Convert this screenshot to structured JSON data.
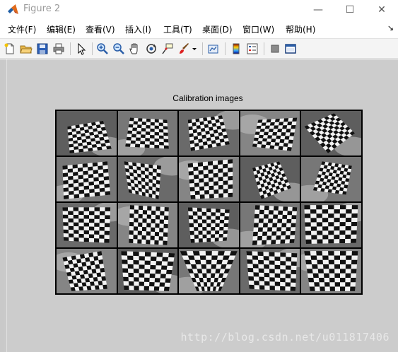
{
  "window": {
    "title": "Figure 2",
    "minimize_glyph": "—",
    "maximize_glyph": "☐",
    "close_glyph": "✕"
  },
  "menu": {
    "items": [
      "文件(F)",
      "编辑(E)",
      "查看(V)",
      "插入(I)",
      "工具(T)",
      "桌面(D)",
      "窗口(W)",
      "帮助(H)"
    ],
    "overflow_arrow": "↘"
  },
  "toolbar": {
    "icons": [
      "new-figure-icon",
      "open-file-icon",
      "save-icon",
      "print-icon",
      "select-arrow-icon",
      "zoom-in-icon",
      "zoom-out-icon",
      "pan-hand-icon",
      "rotate-3d-icon",
      "data-cursor-icon",
      "brush-icon",
      "brush-dropdown-icon",
      "link-plot-icon",
      "colorbar-icon",
      "legend-icon",
      "hide-plot-tools-icon",
      "show-plot-tools-icon"
    ]
  },
  "figure": {
    "axes_title": "Calibration images",
    "grid_rows": 4,
    "grid_cols": 5,
    "background_color": "#cccccc"
  },
  "watermark": "http://blog.csdn.net/u011817406"
}
